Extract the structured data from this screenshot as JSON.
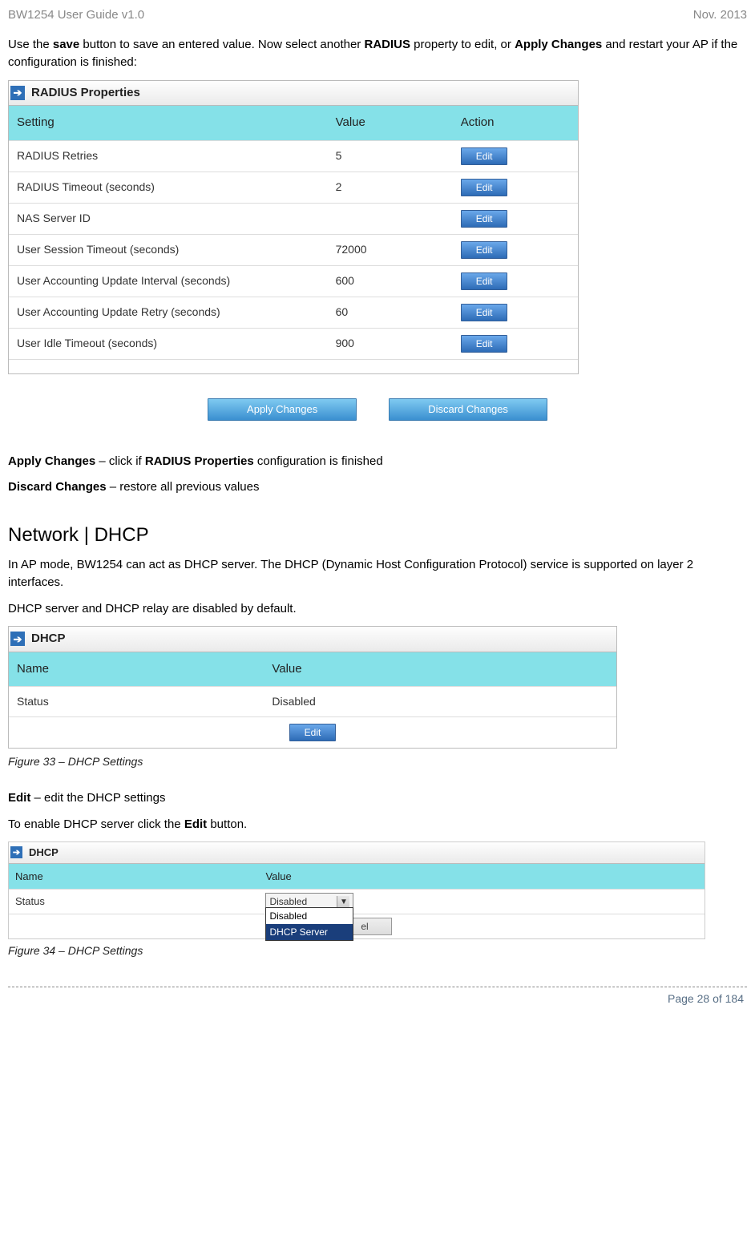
{
  "header": {
    "left": "BW1254 User Guide v1.0",
    "right": "Nov.  2013"
  },
  "intro": {
    "p1a": "Use the ",
    "p1b": "save",
    "p1c": " button to save an entered value. Now select another ",
    "p1d": "RADIUS",
    "p1e": " property to edit, or ",
    "p1f": "Apply Changes",
    "p1g": " and restart your AP if the configuration is finished:"
  },
  "radius": {
    "title": "RADIUS Properties",
    "head_setting": "Setting",
    "head_value": "Value",
    "head_action": "Action",
    "rows": [
      {
        "setting": "RADIUS Retries",
        "value": "5"
      },
      {
        "setting": "RADIUS Timeout (seconds)",
        "value": "2"
      },
      {
        "setting": "NAS Server ID",
        "value": ""
      },
      {
        "setting": "User Session Timeout (seconds)",
        "value": "72000"
      },
      {
        "setting": "User Accounting Update Interval (seconds)",
        "value": "600"
      },
      {
        "setting": "User Accounting Update Retry (seconds)",
        "value": "60"
      },
      {
        "setting": "User Idle Timeout (seconds)",
        "value": "900"
      }
    ],
    "edit_label": "Edit"
  },
  "changes": {
    "apply": "Apply Changes",
    "discard": "Discard Changes"
  },
  "apply_line": {
    "a": "Apply Changes",
    "b": " – click if ",
    "c": "RADIUS Properties",
    "d": " configuration is finished"
  },
  "discard_line": {
    "a": "Discard Changes",
    "b": " – restore all previous values"
  },
  "dhcp_section": {
    "heading": "Network | DHCP",
    "p1": "In AP mode, BW1254 can act as DHCP server. The DHCP (Dynamic Host Configuration Protocol) service is supported on layer 2 interfaces.",
    "p2": "DHCP server and DHCP relay are disabled by default."
  },
  "dhcp_panel": {
    "title": "DHCP",
    "head_name": "Name",
    "head_value": "Value",
    "status_label": "Status",
    "status_value": "Disabled",
    "edit_label": "Edit"
  },
  "fig33": "Figure 33 – DHCP Settings",
  "edit_line": {
    "a": "Edit",
    "b": " – edit the DHCP settings"
  },
  "enable_line": {
    "a": "To enable DHCP server click the ",
    "b": "Edit",
    "c": " button."
  },
  "dhcp2": {
    "title": "DHCP",
    "head_name": "Name",
    "head_value": "Value",
    "status_label": "Status",
    "selected": "Disabled",
    "options": {
      "opt1": "Disabled",
      "opt2": "DHCP Server"
    },
    "btn_hidden": "el"
  },
  "fig34": "Figure 34 – DHCP Settings",
  "footer": "Page 28 of 184"
}
